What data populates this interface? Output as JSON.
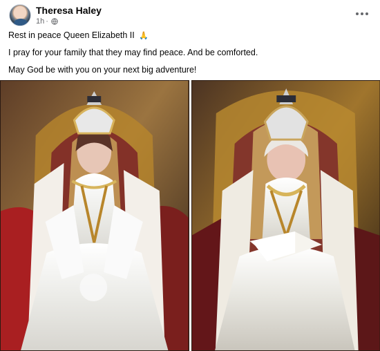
{
  "post": {
    "author": "Theresa Haley",
    "time": "1h",
    "separator": "·",
    "privacy_icon": "globe-icon",
    "more_icon": "more-options-icon",
    "lines": [
      "Rest in peace Queen Elizabeth II",
      "I pray for your family that they may find peace.  And be comforted.",
      "May God be with you on your next big adventure!"
    ],
    "line_icon": "🙏"
  },
  "photos": [
    {
      "icon": "photo-young-queen"
    },
    {
      "icon": "photo-elder-queen"
    }
  ],
  "colors": {
    "text": "#050505",
    "secondary": "#65676b",
    "gold": "#b8862b",
    "throne_red": "#8f2a2a",
    "gown_white": "#f2f2f0"
  }
}
